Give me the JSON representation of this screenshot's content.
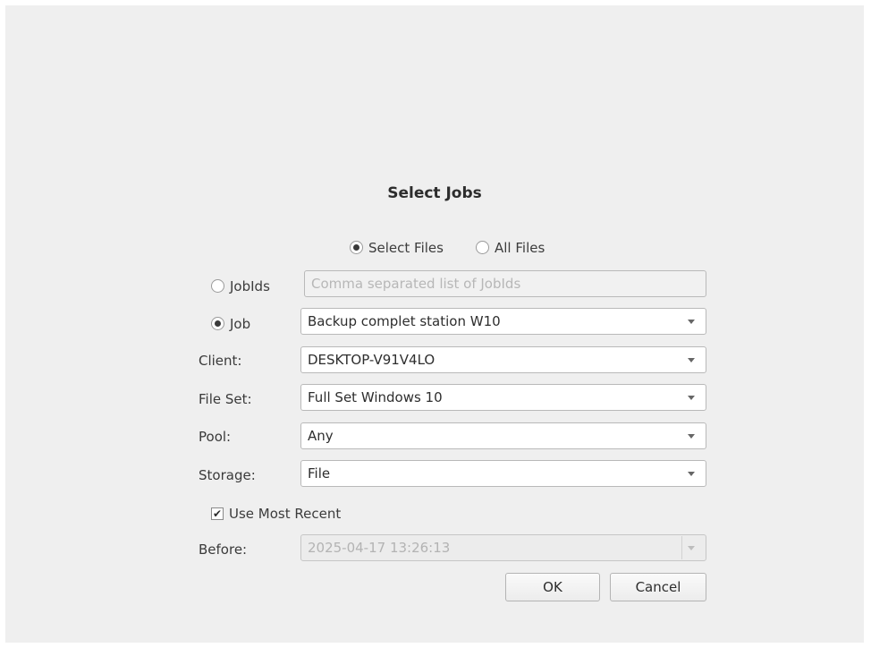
{
  "dialog": {
    "title": "Select Jobs"
  },
  "file_scope": {
    "options": [
      {
        "label": "Select Files",
        "checked": true
      },
      {
        "label": "All Files",
        "checked": false
      }
    ]
  },
  "jobids": {
    "label": "JobIds",
    "checked": false,
    "placeholder": "Comma separated list of JobIds"
  },
  "job": {
    "label": "Job",
    "checked": true,
    "value": "Backup complet station W10"
  },
  "client": {
    "label": "Client:",
    "value": "DESKTOP-V91V4LO"
  },
  "fileset": {
    "label": "File Set:",
    "value": "Full Set Windows 10"
  },
  "pool": {
    "label": "Pool:",
    "value": "Any"
  },
  "storage": {
    "label": "Storage:",
    "value": "File"
  },
  "use_most_recent": {
    "label": "Use Most Recent",
    "checked": true,
    "check_glyph": "✔"
  },
  "before": {
    "label": "Before:",
    "value": "2025-04-17 13:26:13"
  },
  "buttons": {
    "ok": "OK",
    "cancel": "Cancel"
  }
}
